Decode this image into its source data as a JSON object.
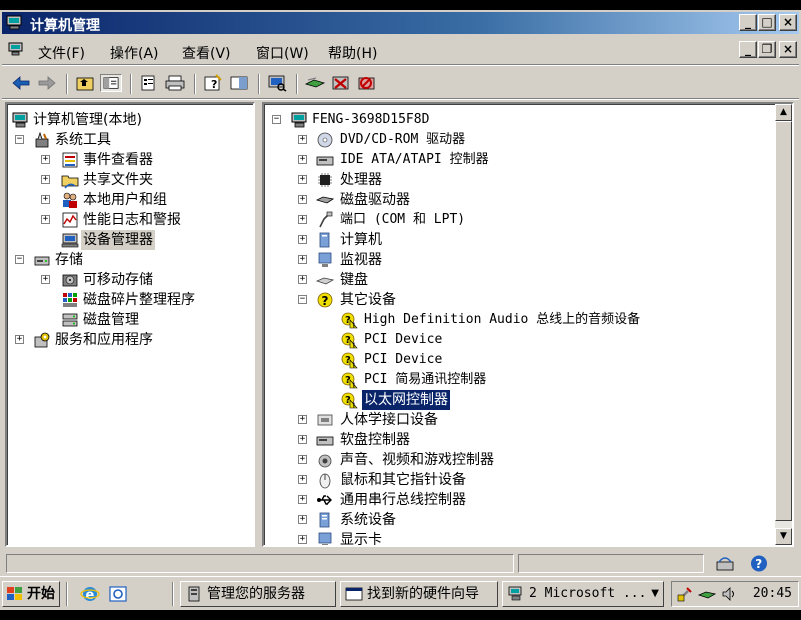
{
  "window": {
    "title": "计算机管理"
  },
  "menu": {
    "items": [
      {
        "label": "文件(F)"
      },
      {
        "label": "操作(A)"
      },
      {
        "label": "查看(V)"
      },
      {
        "label": "窗口(W)"
      },
      {
        "label": "帮助(H)"
      }
    ]
  },
  "left_tree": {
    "items": [
      {
        "label": "计算机管理(本地)",
        "icon": "computer-management-icon"
      },
      {
        "label": "系统工具",
        "icon": "tools-icon"
      },
      {
        "label": "事件查看器",
        "icon": "event-viewer-icon"
      },
      {
        "label": "共享文件夹",
        "icon": "shared-folder-icon"
      },
      {
        "label": "本地用户和组",
        "icon": "users-icon"
      },
      {
        "label": "性能日志和警报",
        "icon": "performance-icon"
      },
      {
        "label": "设备管理器",
        "icon": "device-manager-icon"
      },
      {
        "label": "存储",
        "icon": "storage-icon"
      },
      {
        "label": "可移动存储",
        "icon": "removable-storage-icon"
      },
      {
        "label": "磁盘碎片整理程序",
        "icon": "defrag-icon"
      },
      {
        "label": "磁盘管理",
        "icon": "disk-management-icon"
      },
      {
        "label": "服务和应用程序",
        "icon": "services-icon"
      }
    ]
  },
  "device_tree": {
    "root": "FENG-3698D15F8D",
    "items": [
      {
        "label": "DVD/CD-ROM 驱动器",
        "icon": "cdrom-icon"
      },
      {
        "label": "IDE ATA/ATAPI 控制器",
        "icon": "ide-icon"
      },
      {
        "label": "处理器",
        "icon": "processor-icon"
      },
      {
        "label": "磁盘驱动器",
        "icon": "disk-drive-icon"
      },
      {
        "label": "端口 (COM 和 LPT)",
        "icon": "port-icon"
      },
      {
        "label": "计算机",
        "icon": "computer-icon"
      },
      {
        "label": "监视器",
        "icon": "monitor-icon"
      },
      {
        "label": "键盘",
        "icon": "keyboard-icon"
      },
      {
        "label": "其它设备",
        "icon": "unknown-device-icon"
      },
      {
        "label": "High Definition Audio 总线上的音频设备",
        "icon": "warning-device-icon"
      },
      {
        "label": "PCI Device",
        "icon": "warning-device-icon"
      },
      {
        "label": "PCI Device",
        "icon": "warning-device-icon"
      },
      {
        "label": "PCI 简易通讯控制器",
        "icon": "warning-device-icon"
      },
      {
        "label": "以太网控制器",
        "icon": "warning-device-icon"
      },
      {
        "label": "人体学接口设备",
        "icon": "hid-icon"
      },
      {
        "label": "软盘控制器",
        "icon": "floppy-controller-icon"
      },
      {
        "label": "声音、视频和游戏控制器",
        "icon": "sound-icon"
      },
      {
        "label": "鼠标和其它指针设备",
        "icon": "mouse-icon"
      },
      {
        "label": "通用串行总线控制器",
        "icon": "usb-icon"
      },
      {
        "label": "系统设备",
        "icon": "system-device-icon"
      },
      {
        "label": "显示卡",
        "icon": "display-adapter-icon"
      }
    ]
  },
  "taskbar": {
    "start_label": "开始",
    "tasks": [
      {
        "label": "管理您的服务器"
      },
      {
        "label": "找到新的硬件向导"
      },
      {
        "label": "2 Microsoft ..."
      }
    ],
    "clock": "20:45"
  },
  "colors": {
    "selection": "#0a246a",
    "face": "#d4d0c8"
  }
}
